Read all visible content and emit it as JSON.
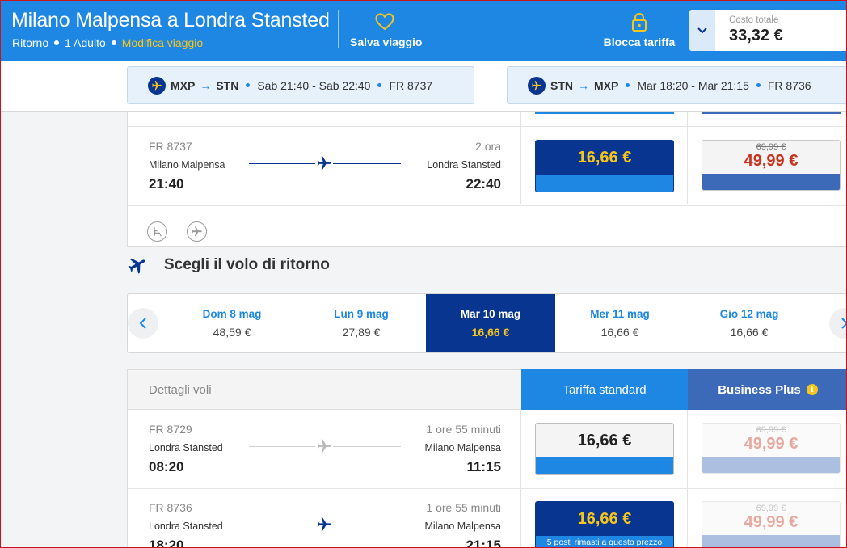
{
  "header": {
    "route_title": "Milano Malpensa a Londra Stansted",
    "trip_type": "Ritorno",
    "passengers": "1 Adulto",
    "edit_trip": "Modifica viaggio",
    "save_trip": "Salva viaggio",
    "lock_fare": "Blocca tariffa",
    "total_label": "Costo totale",
    "total_value": "33,32 €"
  },
  "sticky": {
    "outbound": {
      "from": "MXP",
      "to": "STN",
      "times": "Sab 21:40 - Sab 22:40",
      "flight": "FR 8737"
    },
    "return": {
      "from": "STN",
      "to": "MXP",
      "times": "Mar 18:20 - Mar 21:15",
      "flight": "FR 8736"
    }
  },
  "outbound_flight": {
    "number": "FR 8737",
    "duration": "2 ora",
    "from": "Milano Malpensa",
    "to": "Londra Stansted",
    "depart": "21:40",
    "arrive": "22:40",
    "standard_price": "16,66 €",
    "business_old_price": "69,99 €",
    "business_price": "49,99 €"
  },
  "return_section": {
    "heading": "Scegli il volo di ritorno",
    "dates": [
      {
        "day": "Dom 8 mag",
        "price": "48,59 €"
      },
      {
        "day": "Lun 9 mag",
        "price": "27,89 €"
      },
      {
        "day": "Mar 10 mag",
        "price": "16,66 €"
      },
      {
        "day": "Mer 11 mag",
        "price": "16,66 €"
      },
      {
        "day": "Gio 12 mag",
        "price": "16,66 €"
      }
    ],
    "table_header": {
      "details": "Dettagli voli",
      "standard": "Tariffa standard",
      "business": "Business Plus",
      "info_glyph": "i"
    },
    "flights": [
      {
        "number": "FR 8729",
        "duration": "1 ore 55 minuti",
        "from": "Londra Stansted",
        "to": "Milano Malpensa",
        "depart": "08:20",
        "arrive": "11:15",
        "standard_price": "16,66 €",
        "business_old_price": "69,99 €",
        "business_price": "49,99 €"
      },
      {
        "number": "FR 8736",
        "duration": "1 ore 55 minuti",
        "from": "Londra Stansted",
        "to": "Milano Malpensa",
        "depart": "18:20",
        "arrive": "21:15",
        "standard_price": "16,66 €",
        "seats_notice": "5 posti rimasti a questo prezzo",
        "business_old_price": "69,99 €",
        "business_price": "49,99 €"
      }
    ]
  },
  "colors": {
    "brand_blue": "#1d87e3",
    "navy": "#073590",
    "yellow": "#f7c51b",
    "business_blue": "#3c69b8",
    "business_price_red": "#c8331d"
  },
  "icons": {
    "save": "heart-icon",
    "lock": "padlock-icon",
    "chevron": "chevron-down-icon",
    "plane": "plane-icon",
    "amenity_seat": "seat-icon",
    "amenity_plane": "plane-circle-icon",
    "prev": "chevron-left-icon",
    "next": "chevron-right-icon"
  }
}
